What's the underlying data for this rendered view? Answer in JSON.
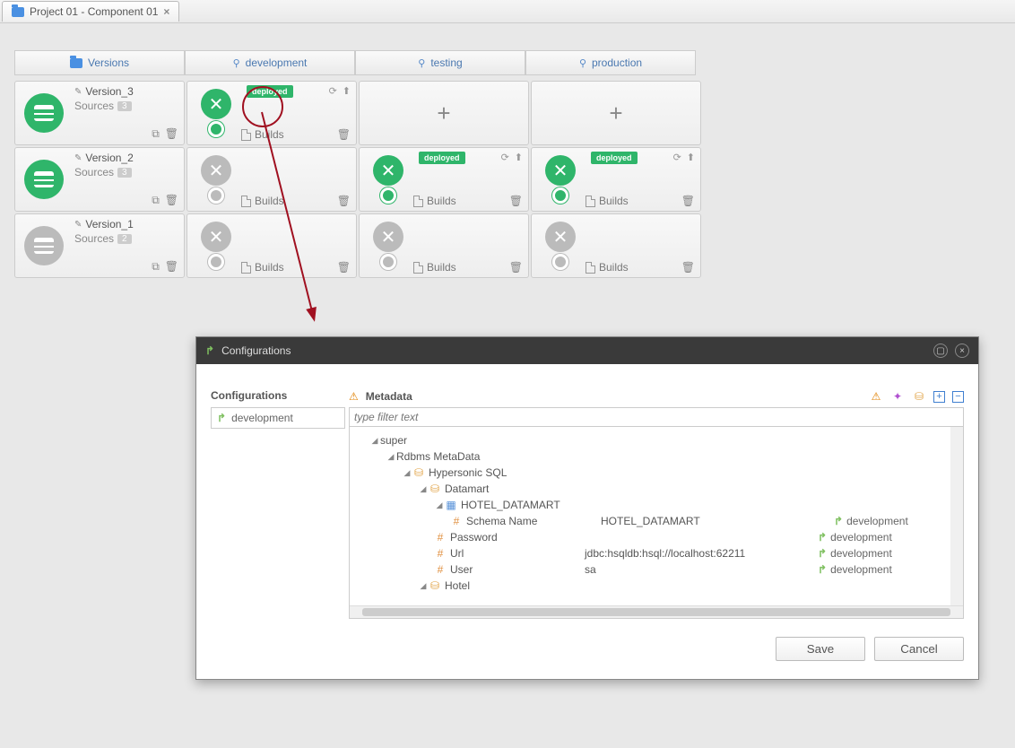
{
  "tab": {
    "title": "Project 01 - Component 01"
  },
  "columns": [
    "Versions",
    "development",
    "testing",
    "production"
  ],
  "versions": [
    {
      "name": "Version_3",
      "sources_label": "Sources",
      "count": "3",
      "active": true
    },
    {
      "name": "Version_2",
      "sources_label": "Sources",
      "count": "3",
      "active": true
    },
    {
      "name": "Version_1",
      "sources_label": "Sources",
      "count": "2",
      "active": false
    }
  ],
  "builds_label": "Builds",
  "deployed_label": "deployed",
  "dialog": {
    "title": "Configurations",
    "left_header": "Configurations",
    "config_item": "development",
    "right_header": "Metadata",
    "filter_placeholder": "type filter text",
    "tree": {
      "root": "super",
      "rdbms": "Rdbms MetaData",
      "hypersonic": "Hypersonic SQL",
      "datamart": "Datamart",
      "hotel_dm": "HOTEL_DATAMART",
      "rows": [
        {
          "key": "Schema Name",
          "value": "HOTEL_DATAMART",
          "env": "development"
        },
        {
          "key": "Password",
          "value": "",
          "env": "development"
        },
        {
          "key": "Url",
          "value": "jdbc:hsqldb:hsql://localhost:62211",
          "env": "development"
        },
        {
          "key": "User",
          "value": "sa",
          "env": "development"
        }
      ],
      "hotel": "Hotel"
    },
    "save": "Save",
    "cancel": "Cancel"
  }
}
